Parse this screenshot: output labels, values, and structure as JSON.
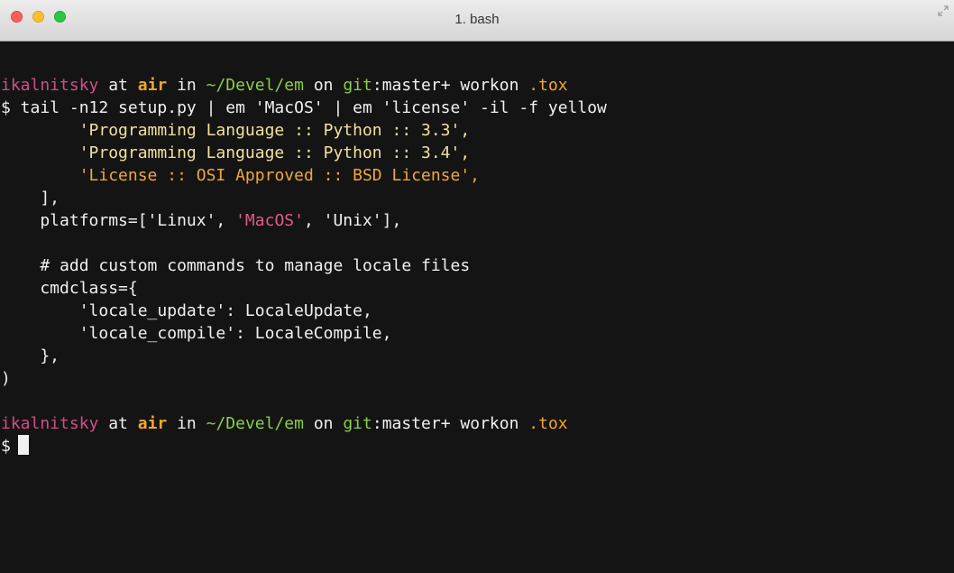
{
  "window": {
    "title": "1. bash"
  },
  "colors": {
    "user": "#d04d8a",
    "host": "#f5a623",
    "path": "#8ccf3f",
    "highlight_yellow": "#f0a830",
    "highlight_magenta": "#e05a8c",
    "background": "#141414"
  },
  "prompt1": {
    "user": "ikalnitsky",
    "at": " at ",
    "host": "air",
    "in": " in ",
    "path": "~/Devel/em",
    "on": " on ",
    "git_label": "git",
    "branch": ":master+",
    "workon": " workon ",
    "env": ".tox"
  },
  "command1": "$ tail -n12 setup.py | em 'MacOS' | em 'license' -il -f yellow",
  "output": {
    "l1": "        'Programming Language :: Python :: 3.3',",
    "l2": "        'Programming Language :: Python :: 3.4',",
    "l3_indent": "        ",
    "l3_highlight": "'License :: OSI Approved :: BSD License',",
    "l4": "    ],",
    "l5_pre": "    platforms=['Linux', ",
    "l5_highlight": "'MacOS'",
    "l5_post": ", 'Unix'],",
    "l6": "    # add custom commands to manage locale files",
    "l7": "    cmdclass={",
    "l8": "        'locale_update': LocaleUpdate,",
    "l9": "        'locale_compile': LocaleCompile,",
    "l10": "    },",
    "l11": ")"
  },
  "prompt2": {
    "user": "ikalnitsky",
    "at": " at ",
    "host": "air",
    "in": " in ",
    "path": "~/Devel/em",
    "on": " on ",
    "git_label": "git",
    "branch": ":master+",
    "workon": " workon ",
    "env": ".tox"
  },
  "command2": "$"
}
